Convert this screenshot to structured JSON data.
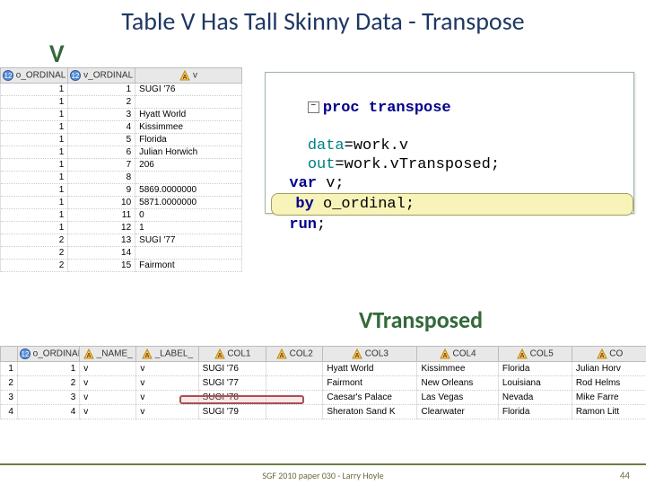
{
  "title": "Table V Has Tall Skinny Data - Transpose",
  "labels": {
    "v": "V",
    "vt": "VTransposed"
  },
  "footer": "SGF 2010 paper 030  - Larry Hoyle",
  "slide_number": "44",
  "tableV": {
    "headers": [
      "o_ORDINAL",
      "v_ORDINAL",
      "v"
    ],
    "rows": [
      [
        "1",
        "1",
        "SUGI '76"
      ],
      [
        "1",
        "2",
        ""
      ],
      [
        "1",
        "3",
        "Hyatt World"
      ],
      [
        "1",
        "4",
        "Kissimmee"
      ],
      [
        "1",
        "5",
        "Florida"
      ],
      [
        "1",
        "6",
        "Julian Horwich"
      ],
      [
        "1",
        "7",
        "206"
      ],
      [
        "1",
        "8",
        ""
      ],
      [
        "1",
        "9",
        "5869.0000000"
      ],
      [
        "1",
        "10",
        "5871.0000000"
      ],
      [
        "1",
        "11",
        "0"
      ],
      [
        "1",
        "12",
        "1"
      ],
      [
        "2",
        "13",
        "SUGI '77"
      ],
      [
        "2",
        "14",
        ""
      ],
      [
        "2",
        "15",
        "Fairmont"
      ]
    ]
  },
  "code": {
    "l1_kw": "proc transpose",
    "l2a": "data",
    "l2b": "=work.v",
    "l3a": "out",
    "l3b": "=work.vTransposed;",
    "l4a": "var ",
    "l4b": "v;",
    "l5a": "by ",
    "l5b": "o_ordinal;",
    "l6": "run",
    "l6b": ";",
    "toggle": "−"
  },
  "tableT": {
    "headers": [
      "o_ORDINAL",
      "_NAME_",
      "_LABEL_",
      "COL1",
      "COL2",
      "COL3",
      "COL4",
      "COL5",
      "CO"
    ],
    "rows": [
      [
        "1",
        "v",
        "v",
        "SUGI '76",
        "",
        "Hyatt World",
        "Kissimmee",
        "Florida",
        "Julian Horv"
      ],
      [
        "2",
        "v",
        "v",
        "SUGI '77",
        "",
        "Fairmont",
        "New Orleans",
        "Louisiana",
        "Rod Helms"
      ],
      [
        "3",
        "v",
        "v",
        "SUGI '78",
        "",
        "Caesar's Palace",
        "Las Vegas",
        "Nevada",
        "Mike Farre"
      ],
      [
        "4",
        "v",
        "v",
        "SUGI '79",
        "",
        "Sheraton Sand K",
        "Clearwater",
        "Florida",
        "Ramon Litt"
      ]
    ]
  }
}
